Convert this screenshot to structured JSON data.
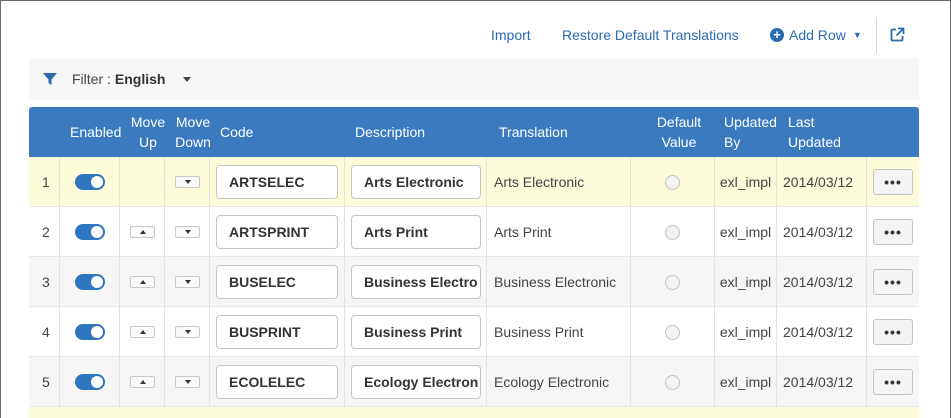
{
  "toolbar": {
    "import_label": "Import",
    "restore_label": "Restore Default Translations",
    "add_row_label": "Add Row"
  },
  "filter": {
    "label": "Filter :",
    "value": "English"
  },
  "columns": {
    "enabled": "Enabled",
    "move_up_1": "Move",
    "move_up_2": "Up",
    "move_down_1": "Move",
    "move_down_2": "Down",
    "code": "Code",
    "description": "Description",
    "translation": "Translation",
    "default_value_1": "Default",
    "default_value_2": "Value",
    "updated_by_1": "Updated",
    "updated_by_2": "By",
    "last_updated_1": "Last",
    "last_updated_2": "Updated"
  },
  "rows": [
    {
      "num": "1",
      "code": "ARTSELEC",
      "description": "Arts Electronic",
      "translation": "Arts Electronic",
      "updated_by": "exl_impl",
      "last_updated": "2014/03/12",
      "actions": "•••"
    },
    {
      "num": "2",
      "code": "ARTSPRINT",
      "description": "Arts Print",
      "translation": "Arts Print",
      "updated_by": "exl_impl",
      "last_updated": "2014/03/12",
      "actions": "•••"
    },
    {
      "num": "3",
      "code": "BUSELEC",
      "description": "Business Electro",
      "translation": "Business Electronic",
      "updated_by": "exl_impl",
      "last_updated": "2014/03/12",
      "actions": "•••"
    },
    {
      "num": "4",
      "code": "BUSPRINT",
      "description": "Business Print",
      "translation": "Business Print",
      "updated_by": "exl_impl",
      "last_updated": "2014/03/12",
      "actions": "•••"
    },
    {
      "num": "5",
      "code": "ECOLELEC",
      "description": "Ecology Electron",
      "translation": "Ecology Electronic",
      "updated_by": "exl_impl",
      "last_updated": "2014/03/12",
      "actions": "•••"
    }
  ],
  "colors": {
    "header_bg": "#3a7bbf",
    "link": "#2a6bb0",
    "toggle_on": "#2e77c0",
    "selected_row_bg": "#fdfcd9"
  }
}
